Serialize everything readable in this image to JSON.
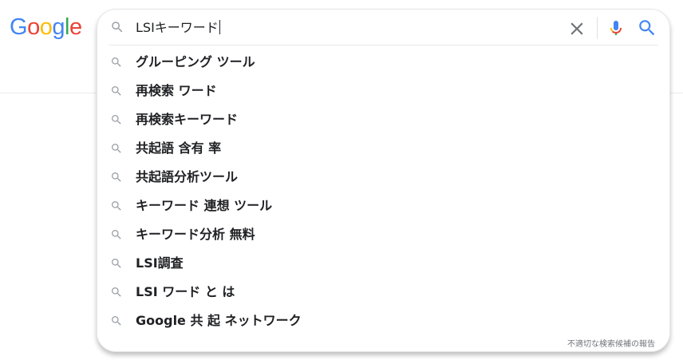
{
  "logo": {
    "letters": [
      {
        "char": "G",
        "color": "#4285F4"
      },
      {
        "char": "o",
        "color": "#EA4335"
      },
      {
        "char": "o",
        "color": "#FBBC05"
      },
      {
        "char": "g",
        "color": "#4285F4"
      },
      {
        "char": "l",
        "color": "#34A853"
      },
      {
        "char": "e",
        "color": "#EA4335"
      }
    ]
  },
  "search": {
    "query": "LSIキーワード",
    "icon": "search-icon",
    "clear_icon": "close-icon",
    "voice_icon": "microphone-icon",
    "submit_icon": "search-icon"
  },
  "suggestions": [
    {
      "text": "グルーピング ツール",
      "icon": "search-icon"
    },
    {
      "text": "再検索 ワード",
      "icon": "search-icon"
    },
    {
      "text": "再検索キーワード",
      "icon": "search-icon"
    },
    {
      "text": "共起語 含有 率",
      "icon": "search-icon"
    },
    {
      "text": "共起語分析ツール",
      "icon": "search-icon"
    },
    {
      "text": "キーワード 連想 ツール",
      "icon": "search-icon"
    },
    {
      "text": "キーワード分析 無料",
      "icon": "search-icon"
    },
    {
      "text": "LSI調査",
      "icon": "search-icon"
    },
    {
      "text": "LSI ワード と は",
      "icon": "search-icon"
    },
    {
      "text": "Google 共 起 ネットワーク",
      "icon": "search-icon"
    }
  ],
  "report_link": "不適切な検索候補の報告",
  "colors": {
    "icon_gray": "#9aa0a6",
    "text": "#202124",
    "blue": "#4285F4",
    "red": "#EA4335",
    "yellow": "#FBBC05",
    "green": "#34A853"
  }
}
